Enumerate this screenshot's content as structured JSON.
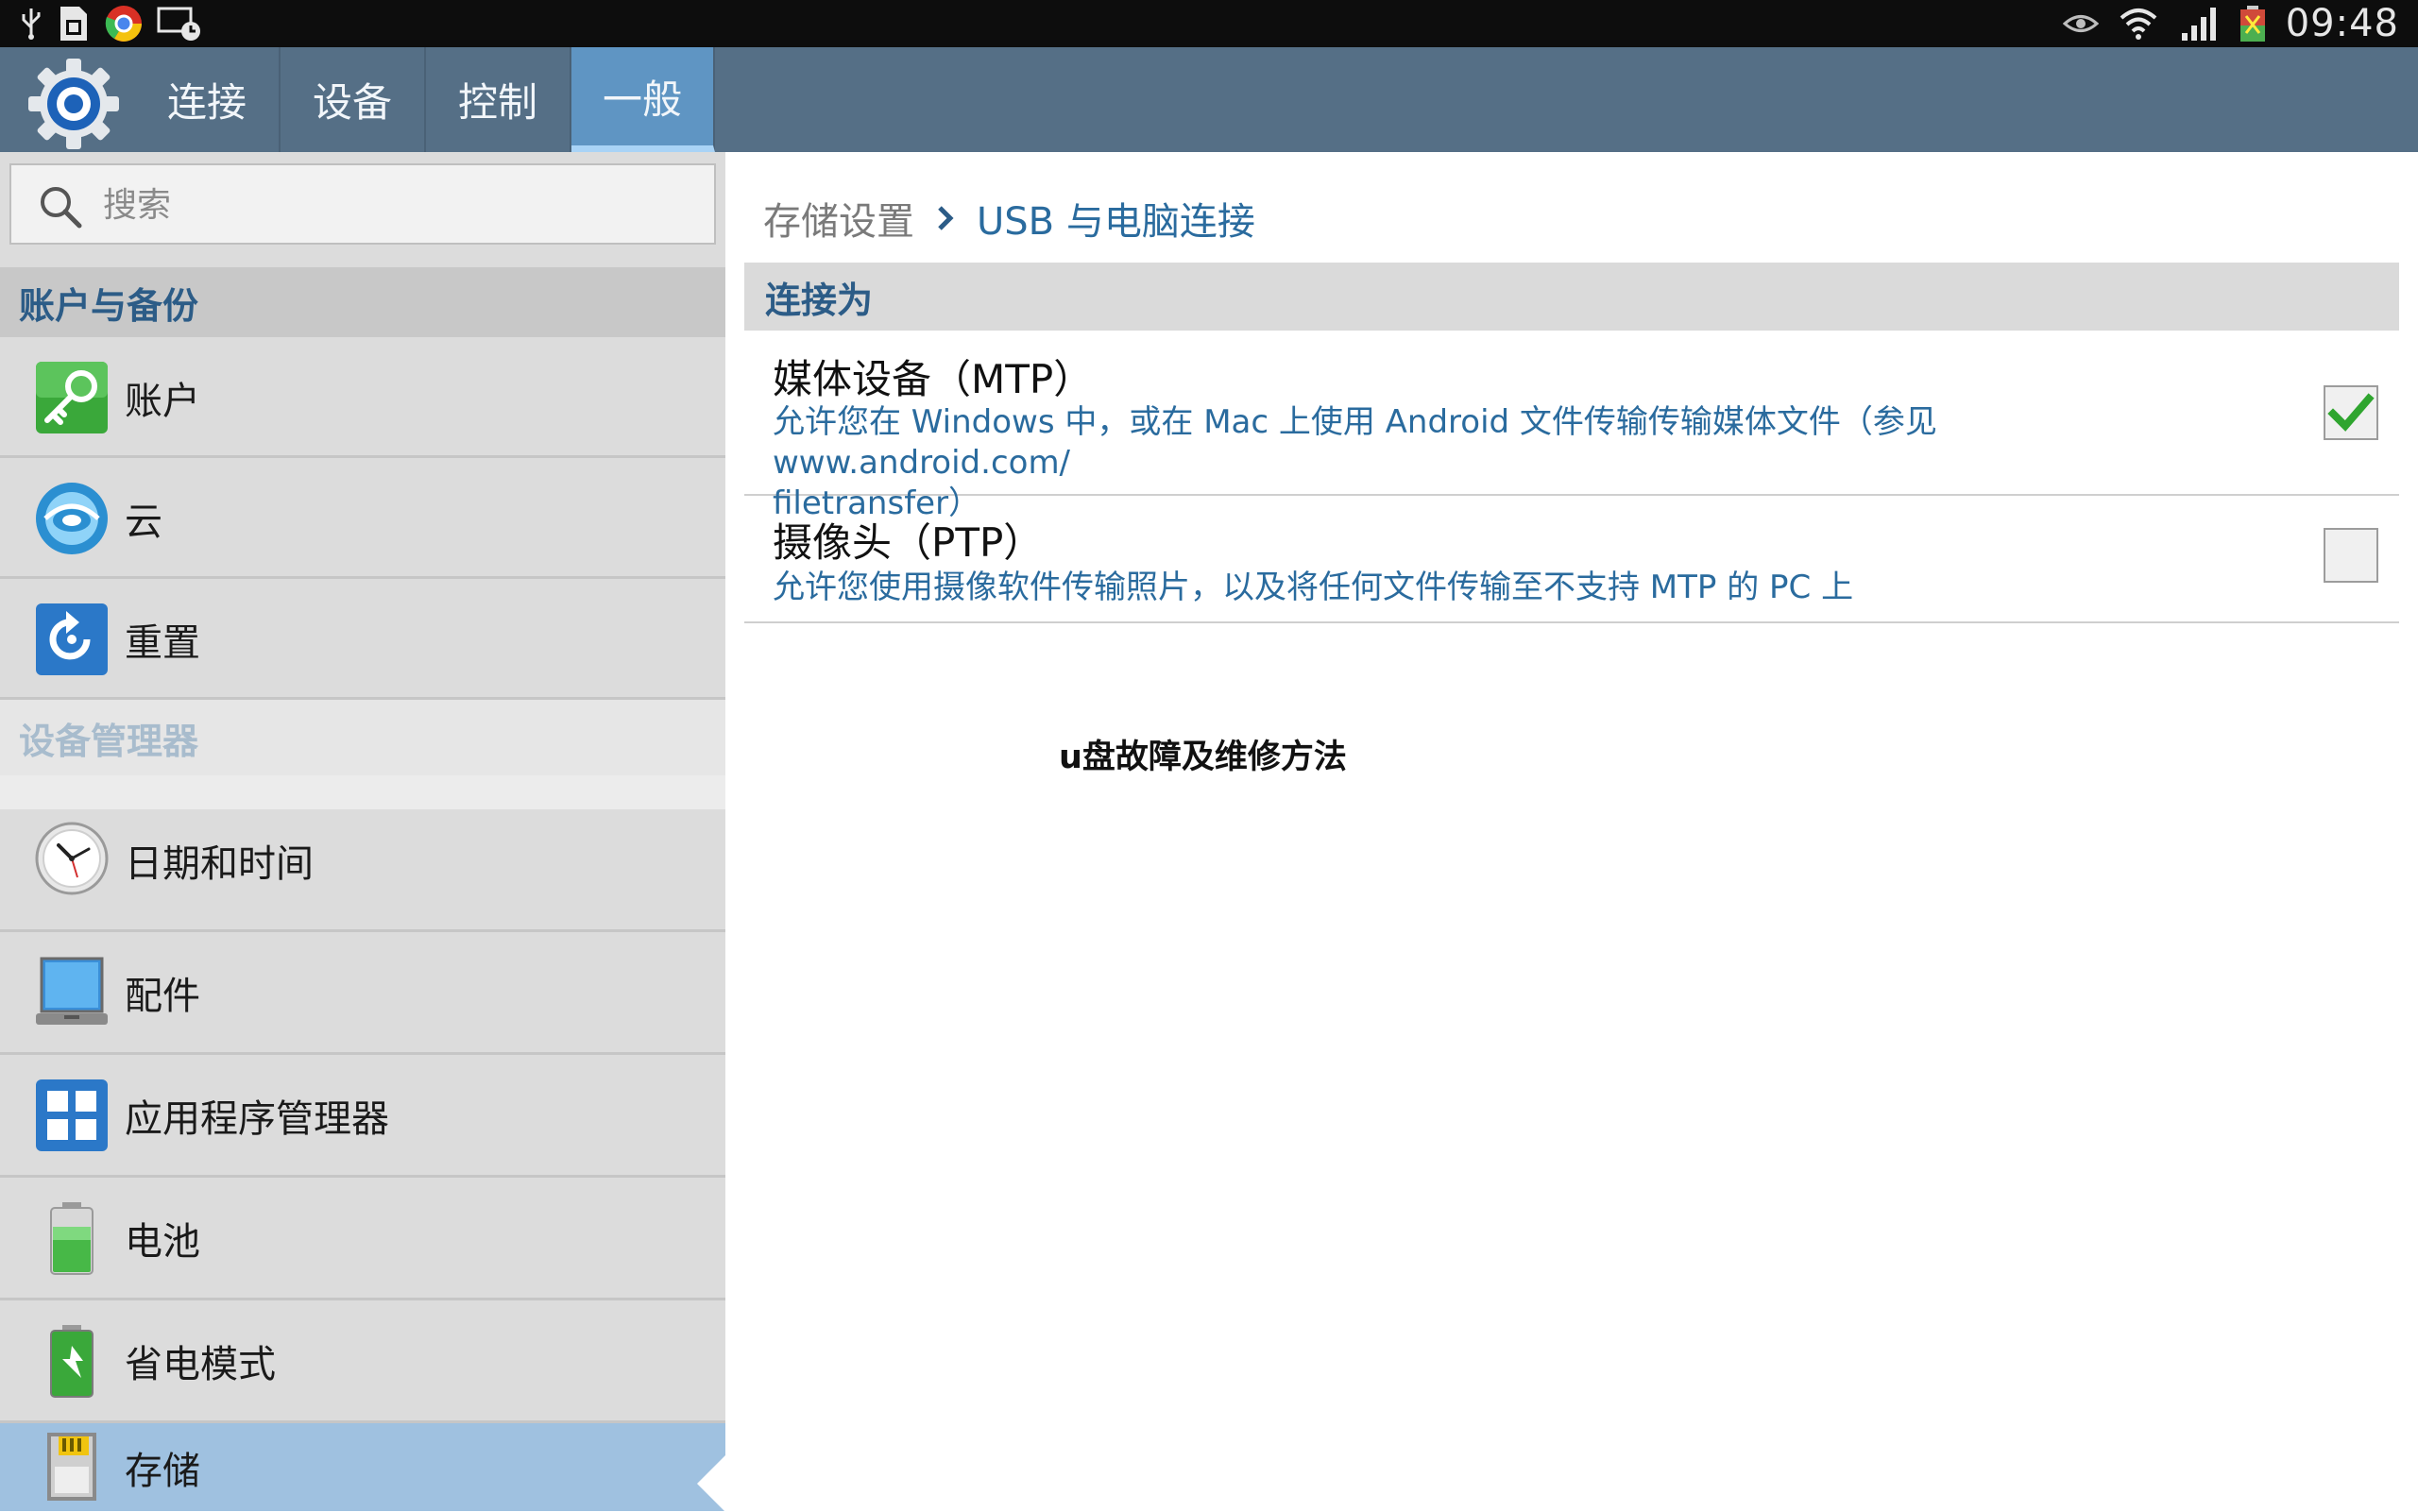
{
  "status_bar": {
    "time": "09:48",
    "left_icons": [
      "usb-icon",
      "sim-icon",
      "chrome-icon",
      "screenshot-icon"
    ],
    "right_icons": [
      "eye-icon",
      "wifi-icon",
      "signal-icon",
      "battery-icon"
    ]
  },
  "action_bar": {
    "app_icon": "gear-icon",
    "tabs": [
      {
        "label": "连接",
        "active": false
      },
      {
        "label": "设备",
        "active": false
      },
      {
        "label": "控制",
        "active": false
      },
      {
        "label": "一般",
        "active": true
      }
    ]
  },
  "sidebar": {
    "search": {
      "placeholder": "搜索",
      "value": ""
    },
    "sections": [
      {
        "header": "账户与备份",
        "items": [
          {
            "label": "账户",
            "icon": "key-icon"
          },
          {
            "label": "云",
            "icon": "cloud-icon"
          },
          {
            "label": "重置",
            "icon": "reset-icon"
          }
        ]
      },
      {
        "header": "设备管理器",
        "items": [
          {
            "label": "日期和时间",
            "icon": "clock-icon"
          },
          {
            "label": "配件",
            "icon": "accessory-icon"
          },
          {
            "label": "应用程序管理器",
            "icon": "apps-icon"
          },
          {
            "label": "电池",
            "icon": "battery-icon"
          },
          {
            "label": "省电模式",
            "icon": "power-saving-icon"
          },
          {
            "label": "存储",
            "icon": "storage-icon",
            "selected": true
          }
        ]
      }
    ]
  },
  "content": {
    "breadcrumb": {
      "parent": "存储设置",
      "current": "USB 与电脑连接"
    },
    "section_header": "连接为",
    "options": [
      {
        "title": "媒体设备（MTP）",
        "desc_line1": "允许您在 Windows 中，或在 Mac 上使用 Android 文件传输传输媒体文件（参见 www.android.com/",
        "desc_line2": "filetransfer）",
        "checked": true
      },
      {
        "title": "摄像头（PTP）",
        "desc_line1": "允许您使用摄像软件传输照片，以及将任何文件传输至不支持 MTP 的 PC 上",
        "checked": false
      }
    ],
    "watermark": "u盘故障及维修方法"
  },
  "colors": {
    "action_bar": "#556f86",
    "active_tab": "#5f95c3",
    "sidebar_bg": "#dcdcdc",
    "selected_item": "#9fc1e0",
    "accent_blue": "#2a6b9e",
    "check_green": "#2fa52f"
  }
}
